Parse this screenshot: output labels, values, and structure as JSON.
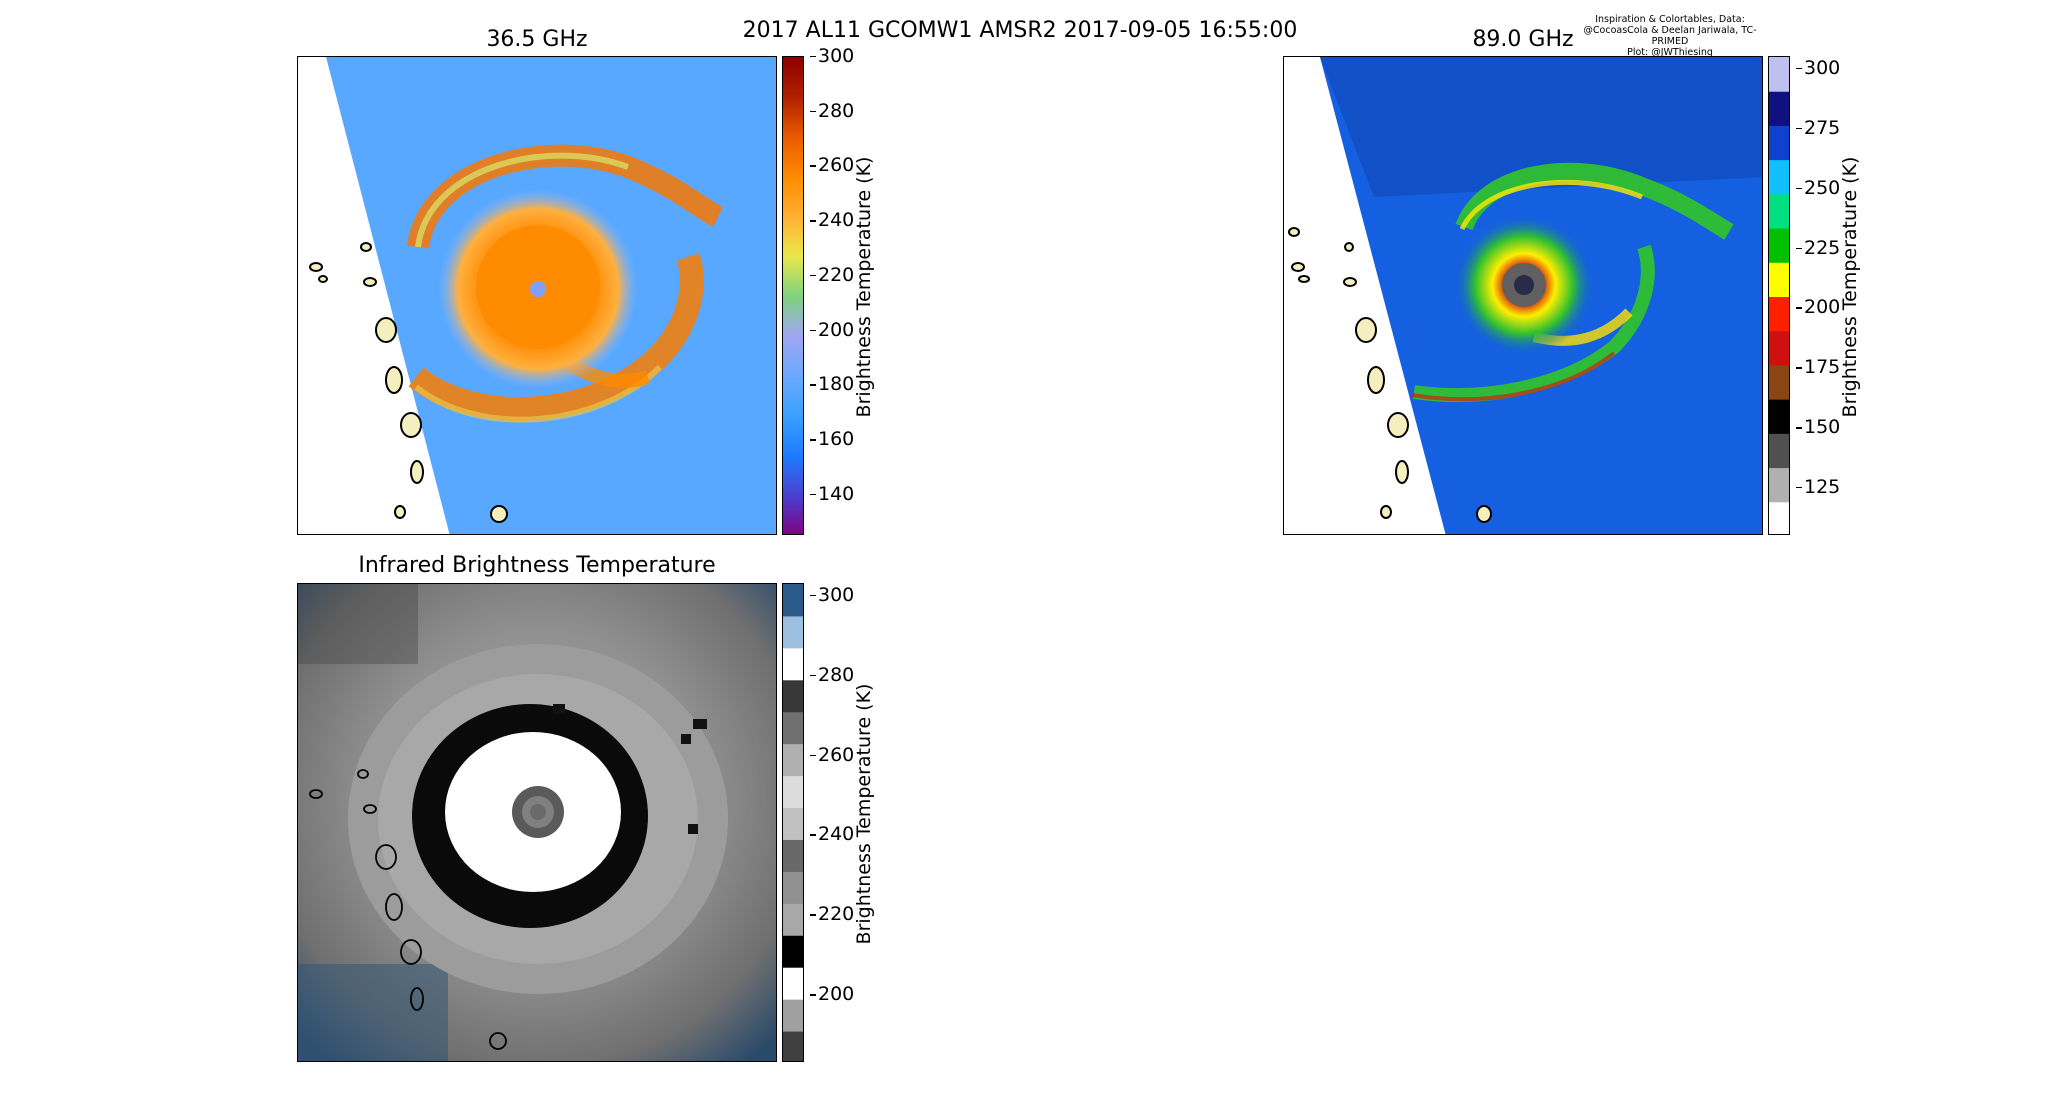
{
  "figure": {
    "suptitle": "2017 AL11 GCOMW1 AMSR2 2017-09-05 16:55:00",
    "credits": [
      "Inspiration & Colortables, Data:",
      "@CocoasCola & Deelan Jariwala, TC-PRIMED",
      "Plot: @JWThiesing"
    ]
  },
  "chart_data": [
    {
      "type": "heatmap",
      "title": "36.5 GHz",
      "colorbar": {
        "label": "Brightness Temperature (K)",
        "ticks": [
          "140",
          "160",
          "180",
          "200",
          "220",
          "240",
          "260",
          "280",
          "300"
        ],
        "range": [
          125,
          300
        ],
        "colors": [
          "#800080",
          "#4b3fd0",
          "#1e7bff",
          "#3aa0ff",
          "#6aa9ff",
          "#9fa6f2",
          "#7fd27f",
          "#e8e84a",
          "#ffb030",
          "#ff8a00",
          "#e85a00",
          "#b02000",
          "#8b0000"
        ]
      },
      "features": {
        "storm_center": "eye near center",
        "swath_edge": "left edge of swath (white, no data)",
        "islands": "Lesser Antilles outlines"
      }
    },
    {
      "type": "heatmap",
      "title": "89.0 GHz",
      "colorbar": {
        "label": "Brightness Temperature (K)",
        "ticks": [
          "125",
          "150",
          "175",
          "200",
          "225",
          "250",
          "275",
          "300"
        ],
        "range": [
          105,
          305
        ],
        "colors": [
          "#ffffff",
          "#b0b0b0",
          "#505050",
          "#000000",
          "#8b4513",
          "#d01010",
          "#ff2000",
          "#ffff00",
          "#00c000",
          "#00e080",
          "#10c0ff",
          "#1040d0",
          "#101080",
          "#c0c0f0"
        ]
      },
      "features": {
        "storm_center": "eye near center",
        "swath_edge": "left edge of swath (white, no data)",
        "islands": "Lesser Antilles outlines"
      }
    },
    {
      "type": "heatmap",
      "title": "Infrared Brightness Temperature",
      "colorbar": {
        "label": "Brightness Temperature (K)",
        "ticks": [
          "200",
          "220",
          "240",
          "260",
          "280",
          "300"
        ],
        "range": [
          183,
          303
        ],
        "colors": [
          "#404040",
          "#a0a0a0",
          "#ffffff",
          "#000000",
          "#a8a8a8",
          "#909090",
          "#686868",
          "#c0c0c0",
          "#dcdcdc",
          "#b0b0b0",
          "#707070",
          "#383838",
          "#ffffff",
          "#9ec0e0",
          "#2a5a8a"
        ]
      },
      "features": {
        "storm_center": "eye near center",
        "islands": "Lesser Antilles outlines"
      }
    }
  ]
}
